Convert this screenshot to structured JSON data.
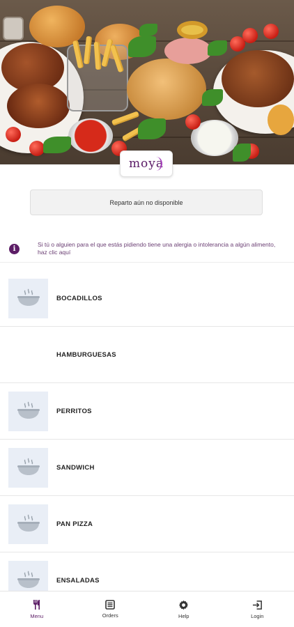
{
  "hero": {
    "image": "food-platter-image",
    "alt_icon": "food-photo"
  },
  "logo": {
    "text": "moya"
  },
  "delivery": {
    "label": "Reparto aún no disponible"
  },
  "allergy": {
    "icon": "info-icon",
    "text": "Si tú o alguien para el que estás pidiendo tiene una alergia o intolerancia a algún alimento, haz clic aquí"
  },
  "categories": [
    {
      "label": "BOCADILLOS",
      "has_thumb": true
    },
    {
      "label": "HAMBURGUESAS",
      "has_thumb": false
    },
    {
      "label": "PERRITOS",
      "has_thumb": true
    },
    {
      "label": "SANDWICH",
      "has_thumb": true
    },
    {
      "label": "PAN PIZZA",
      "has_thumb": true
    },
    {
      "label": "ENSALADAS",
      "has_thumb": true
    }
  ],
  "nav": [
    {
      "label": "Menu",
      "icon": "fork-knife-icon",
      "active": true
    },
    {
      "label": "Orders",
      "icon": "receipt-icon",
      "active": false
    },
    {
      "label": "Help",
      "icon": "gear-icon",
      "active": false
    },
    {
      "label": "Login",
      "icon": "login-icon",
      "active": false
    }
  ],
  "colors": {
    "brand": "#5c1d66",
    "thumb_bg": "#e9eef6",
    "text": "#222222"
  }
}
